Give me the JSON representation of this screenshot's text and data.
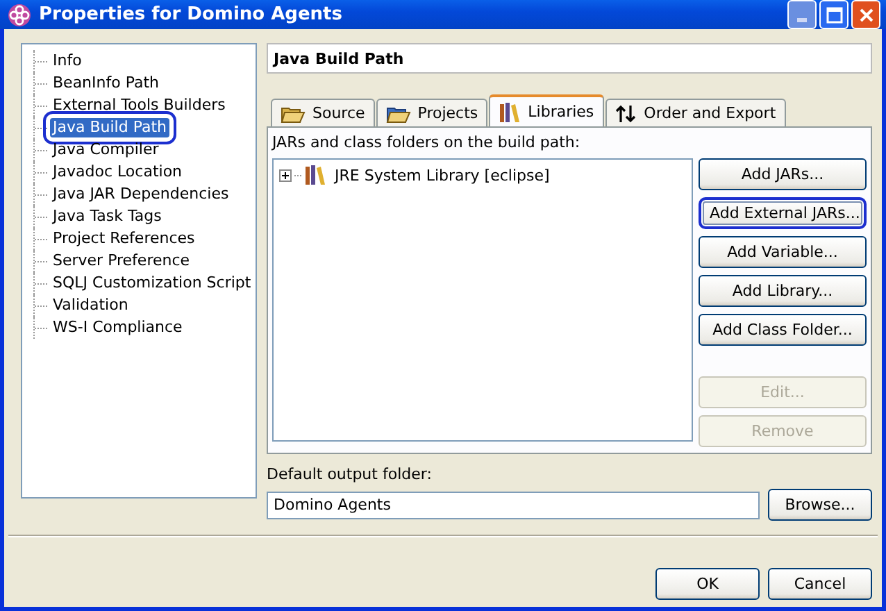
{
  "window": {
    "title": "Properties for Domino Agents"
  },
  "sidebar": {
    "items": [
      {
        "label": "Info",
        "selected": false,
        "highlighted": false
      },
      {
        "label": "BeanInfo Path",
        "selected": false,
        "highlighted": false
      },
      {
        "label": "External Tools Builders",
        "selected": false,
        "highlighted": false
      },
      {
        "label": "Java Build Path",
        "selected": true,
        "highlighted": true
      },
      {
        "label": "Java Compiler",
        "selected": false,
        "highlighted": false
      },
      {
        "label": "Javadoc Location",
        "selected": false,
        "highlighted": false
      },
      {
        "label": "Java JAR Dependencies",
        "selected": false,
        "highlighted": false
      },
      {
        "label": "Java Task Tags",
        "selected": false,
        "highlighted": false
      },
      {
        "label": "Project References",
        "selected": false,
        "highlighted": false
      },
      {
        "label": "Server Preference",
        "selected": false,
        "highlighted": false
      },
      {
        "label": "SQLJ Customization Script",
        "selected": false,
        "highlighted": false
      },
      {
        "label": "Validation",
        "selected": false,
        "highlighted": false
      },
      {
        "label": "WS-I Compliance",
        "selected": false,
        "highlighted": false
      }
    ]
  },
  "page_title": "Java Build Path",
  "tabs": [
    {
      "label": "Source",
      "kind": "source",
      "selected": false
    },
    {
      "label": "Projects",
      "kind": "projects",
      "selected": false
    },
    {
      "label": "Libraries",
      "kind": "libraries",
      "selected": true
    },
    {
      "label": "Order and Export",
      "kind": "order",
      "selected": false
    }
  ],
  "list_label": "JARs and class folders on the build path:",
  "tree": [
    {
      "label": "JRE System Library [eclipse]",
      "expanded": false
    }
  ],
  "side_buttons": [
    {
      "label": "Add JARs...",
      "disabled": false,
      "highlighted": false
    },
    {
      "label": "Add External JARs...",
      "disabled": false,
      "highlighted": true
    },
    {
      "label": "Add Variable...",
      "disabled": false,
      "highlighted": false
    },
    {
      "label": "Add Library...",
      "disabled": false,
      "highlighted": false
    },
    {
      "label": "Add Class Folder...",
      "disabled": false,
      "highlighted": false
    },
    {
      "label": "Edit...",
      "disabled": true,
      "highlighted": false
    },
    {
      "label": "Remove",
      "disabled": true,
      "highlighted": false
    }
  ],
  "output": {
    "label": "Default output folder:",
    "value": "Domino Agents",
    "button": "Browse..."
  },
  "buttons": [
    "OK",
    "Cancel"
  ]
}
